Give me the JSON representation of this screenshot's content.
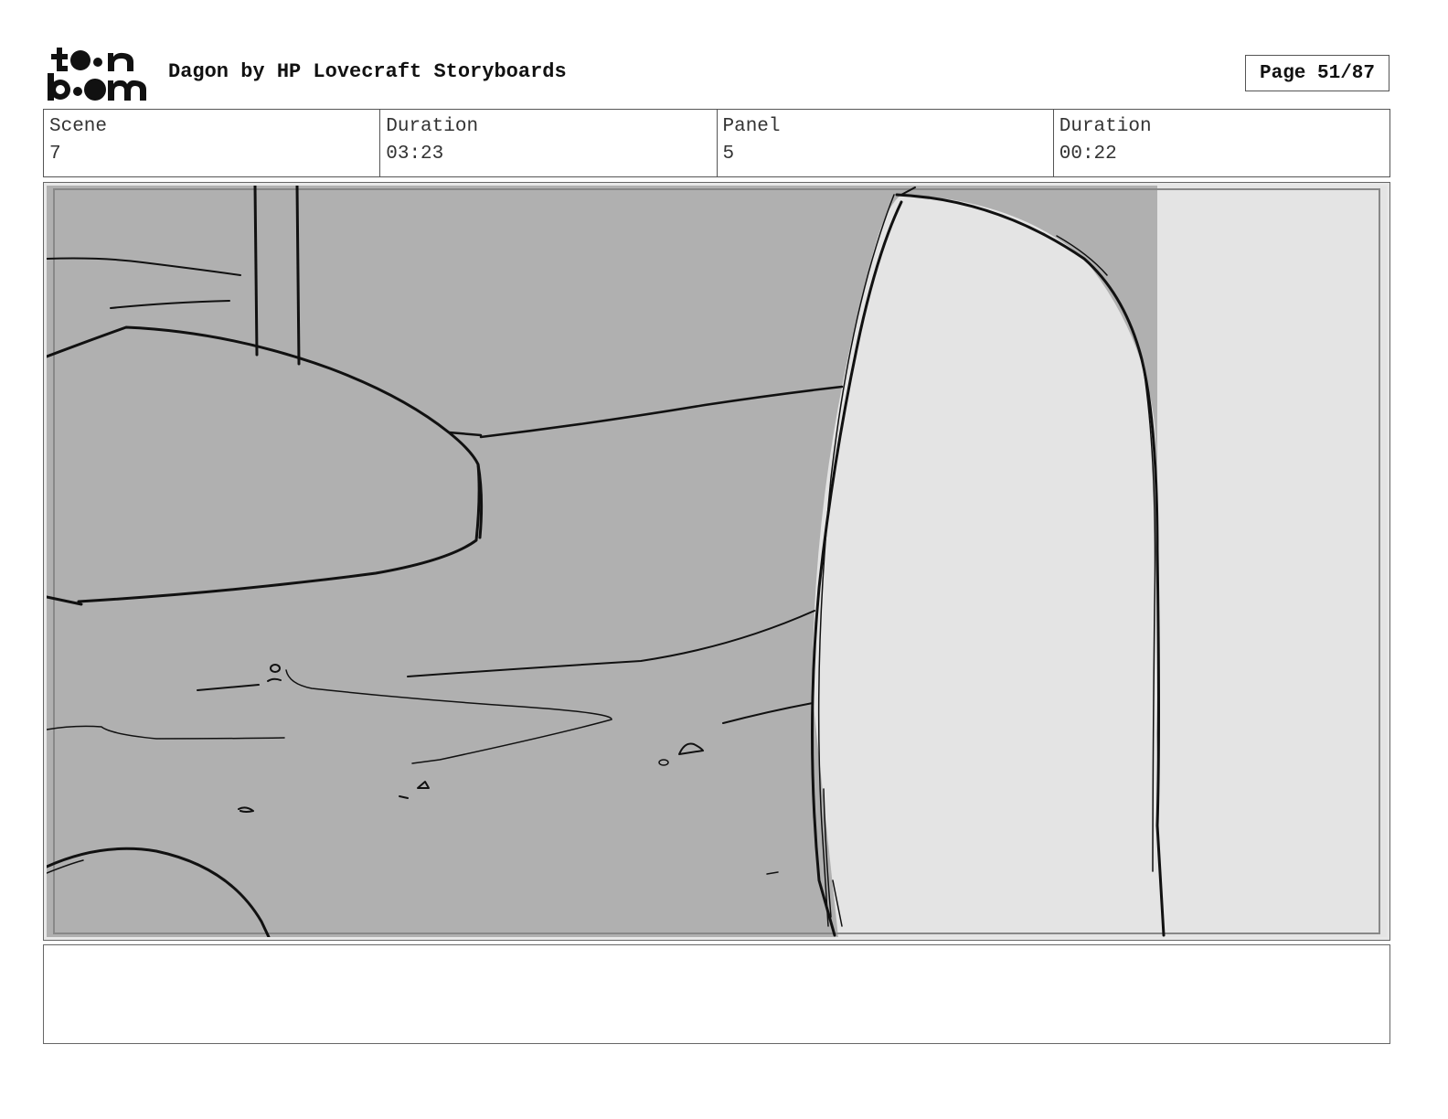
{
  "header": {
    "logo_text": "toon boom",
    "title": "Dagon by HP Lovecraft Storyboards",
    "page": "Page 51/87"
  },
  "info": {
    "scene_label": "Scene",
    "scene_value": "7",
    "scene_duration_label": "Duration",
    "scene_duration_value": "03:23",
    "panel_label": "Panel",
    "panel_value": "5",
    "panel_duration_label": "Duration",
    "panel_duration_value": "00:22"
  },
  "panel": {
    "colors": {
      "background_grey": "#b0b0b0",
      "foreground_light": "#e4e4e4",
      "line": "#111111"
    }
  },
  "notes": {
    "text": ""
  }
}
